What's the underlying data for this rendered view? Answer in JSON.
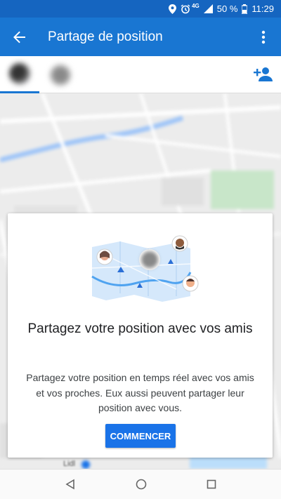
{
  "status_bar": {
    "icons": [
      "location-icon",
      "alarm-icon",
      "signal-icon"
    ],
    "network": "4G",
    "battery": "50 %",
    "time": "11:29"
  },
  "app_bar": {
    "title": "Partage de position",
    "back_icon": "arrow-back-icon",
    "menu_icon": "more-vert-icon"
  },
  "tabs": {
    "avatars": [
      "avatar-blurred",
      "avatar-blurred"
    ],
    "add_icon": "person-add-icon"
  },
  "map": {
    "labels": [
      "Lidl"
    ]
  },
  "card": {
    "title": "Partagez votre position avec vos amis",
    "body": "Partagez votre position en temps réel avec vos amis et vos proches. Eux aussi peuvent partager leur position avec vous.",
    "button": "COMMENCER"
  },
  "colors": {
    "status_bar": "#1565c0",
    "app_bar": "#1976d2",
    "accent": "#1a73e8"
  },
  "nav_bar": {
    "icons": [
      "back-triangle-icon",
      "home-circle-icon",
      "recents-square-icon"
    ]
  }
}
